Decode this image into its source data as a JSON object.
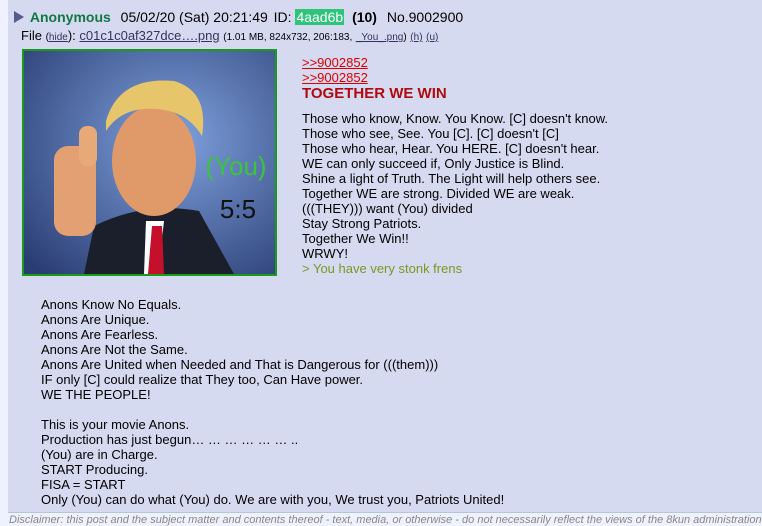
{
  "post": {
    "name": "Anonymous",
    "date": "05/02/20 (Sat) 20:21:49",
    "id_label": "ID:",
    "id_value": "4aad6b",
    "reply_count": "(10)",
    "post_number": "No.9002900"
  },
  "file": {
    "label": "File",
    "hide_open": "(",
    "hide_link": "hide",
    "hide_close": "):",
    "filename": "c01c1c0af327dce….png",
    "meta": "(1.01 MB, 824x732, 206:183,",
    "orig_name": "_You_.png",
    "meta_close": ")",
    "h_link": "(h)",
    "u_link": "(u)"
  },
  "thumbnail": {
    "overlay_you": "(You)",
    "overlay_ratio": "5:5"
  },
  "body": {
    "quotelinks": [
      ">>9002852",
      ">>9002852"
    ],
    "heading": "TOGETHER WE WIN",
    "lines": [
      "Those who know, Know. You Know. [C] doesn't know.",
      "Those who see, See. You [C]. [C] doesn't [C]",
      "Those who hear, Hear. You HERE. [C] doesn't hear.",
      "WE can only succeed if, Only Justice is Blind.",
      "Shine a light of Truth. The Light will help others see.",
      "Together WE are strong. Divided WE are weak.",
      "(((THEY))) want (You) divided",
      "Stay Strong Patriots.",
      "Together We Win!!",
      "WRWY!"
    ],
    "greentext": "> You have very stonk frens",
    "lower_group1": [
      "Anons Know No Equals.",
      "Anons Are Unique.",
      "Anons Are Fearless.",
      "Anons Are Not the Same.",
      "Anons Are United when Needed and That is Dangerous for (((them)))",
      "IF only [C] could realize that They too, Can Have power.",
      "WE THE PEOPLE!"
    ],
    "lower_group2": [
      "This is your movie Anons.",
      "Production has just begun… … … … … … ..",
      "(You) are in Charge.",
      "START Producing.",
      "FISA = START",
      "Only (You) can do what (You) do. We are with you, We trust you, Patriots United!"
    ]
  },
  "disclaimer": "Disclaimer: this post and the subject matter and contents thereof - text, media, or otherwise - do not necessarily reflect the views of the 8kun administration.",
  "colors": {
    "name": "#117743",
    "id_bg": "#2ec47a",
    "heading": "#af0a0f",
    "quotelink": "#dd0000",
    "greentext": "#789922",
    "post_bg": "#d6daf0",
    "page_bg": "#eef2ff"
  }
}
